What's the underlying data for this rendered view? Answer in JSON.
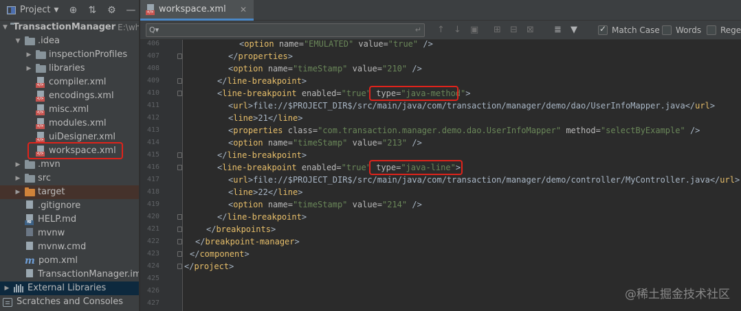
{
  "project_panel": {
    "title": "Project",
    "tree": [
      {
        "label": "TransactionManager",
        "suffix": "E:\\wh",
        "level": 0,
        "kind": "folder",
        "arrow": "▼",
        "bold": true
      },
      {
        "label": ".idea",
        "level": 1,
        "kind": "folder",
        "arrow": "▼"
      },
      {
        "label": "inspectionProfiles",
        "level": 2,
        "kind": "folder",
        "arrow": "▶"
      },
      {
        "label": "libraries",
        "level": 2,
        "kind": "folder",
        "arrow": "▶"
      },
      {
        "label": "compiler.xml",
        "level": 3,
        "kind": "xml"
      },
      {
        "label": "encodings.xml",
        "level": 3,
        "kind": "xml"
      },
      {
        "label": "misc.xml",
        "level": 3,
        "kind": "xml"
      },
      {
        "label": "modules.xml",
        "level": 3,
        "kind": "xml"
      },
      {
        "label": "uiDesigner.xml",
        "level": 3,
        "kind": "xml"
      },
      {
        "label": "workspace.xml",
        "level": 3,
        "kind": "xml"
      },
      {
        "label": ".mvn",
        "level": 1,
        "kind": "folder",
        "arrow": "▶"
      },
      {
        "label": "src",
        "level": 1,
        "kind": "folder",
        "arrow": "▶"
      },
      {
        "label": "target",
        "level": 1,
        "kind": "folder-orange",
        "arrow": "▶",
        "excluded": true
      },
      {
        "label": ".gitignore",
        "level": 2,
        "kind": "ignore"
      },
      {
        "label": "HELP.md",
        "level": 2,
        "kind": "md"
      },
      {
        "label": "mvnw",
        "level": 2,
        "kind": "cmd"
      },
      {
        "label": "mvnw.cmd",
        "level": 2,
        "kind": "plain"
      },
      {
        "label": "pom.xml",
        "level": 2,
        "kind": "maven"
      },
      {
        "label": "TransactionManager.iml",
        "level": 2,
        "kind": "plain"
      },
      {
        "label": "External Libraries",
        "level": 0,
        "kind": "library",
        "arrow": "▶",
        "selected": true
      },
      {
        "label": "Scratches and Consoles",
        "level": 0,
        "kind": "scratch"
      }
    ]
  },
  "editor": {
    "tab_label": "workspace.xml",
    "search": {
      "value": "",
      "options": [
        {
          "label": "Match Case",
          "checked": true
        },
        {
          "label": "Words",
          "checked": false
        },
        {
          "label": "Regex",
          "checked": false
        }
      ]
    },
    "lines": [
      {
        "no": "406",
        "indent": 5,
        "tokens": [
          [
            "x",
            "<"
          ],
          [
            "t",
            "option "
          ],
          [
            "a",
            "name="
          ],
          [
            "v",
            "\"EMULATED\" "
          ],
          [
            "a",
            "value="
          ],
          [
            "v",
            "\"true\" "
          ],
          [
            "x",
            "/>"
          ]
        ]
      },
      {
        "no": "407",
        "indent": 4,
        "tokens": [
          [
            "x",
            "</"
          ],
          [
            "t",
            "properties"
          ],
          [
            "x",
            ">"
          ]
        ]
      },
      {
        "no": "408",
        "indent": 4,
        "tokens": [
          [
            "x",
            "<"
          ],
          [
            "t",
            "option "
          ],
          [
            "a",
            "name="
          ],
          [
            "v",
            "\"timeStamp\" "
          ],
          [
            "a",
            "value="
          ],
          [
            "v",
            "\"210\" "
          ],
          [
            "x",
            "/>"
          ]
        ]
      },
      {
        "no": "409",
        "indent": 3,
        "tokens": [
          [
            "x",
            "</"
          ],
          [
            "t",
            "line-breakpoint"
          ],
          [
            "x",
            ">"
          ]
        ]
      },
      {
        "no": "410",
        "indent": 3,
        "tokens": [
          [
            "x",
            "<"
          ],
          [
            "t",
            "line-breakpoint "
          ],
          [
            "a",
            "enabled="
          ],
          [
            "v",
            "\"true\" "
          ],
          [
            "a",
            "type="
          ],
          [
            "v",
            "\"java-method\""
          ],
          [
            "x",
            ">"
          ]
        ]
      },
      {
        "no": "411",
        "indent": 4,
        "tokens": [
          [
            "x",
            "<"
          ],
          [
            "t",
            "url"
          ],
          [
            "x",
            ">"
          ],
          [
            "x",
            "file://$PROJECT_DIR$/src/main/java/com/transaction/manager/demo/dao/UserInfoMapper.java"
          ],
          [
            "x",
            "</"
          ],
          [
            "t",
            "url"
          ],
          [
            "x",
            ">"
          ]
        ]
      },
      {
        "no": "412",
        "indent": 4,
        "tokens": [
          [
            "x",
            "<"
          ],
          [
            "t",
            "line"
          ],
          [
            "x",
            ">"
          ],
          [
            "x",
            "21"
          ],
          [
            "x",
            "</"
          ],
          [
            "t",
            "line"
          ],
          [
            "x",
            ">"
          ]
        ]
      },
      {
        "no": "413",
        "indent": 4,
        "tokens": [
          [
            "x",
            "<"
          ],
          [
            "t",
            "properties "
          ],
          [
            "a",
            "class="
          ],
          [
            "v",
            "\"com.transaction.manager.demo.dao.UserInfoMapper\" "
          ],
          [
            "a",
            "method="
          ],
          [
            "v",
            "\"selectByExample\" "
          ],
          [
            "x",
            "/>"
          ]
        ]
      },
      {
        "no": "414",
        "indent": 4,
        "tokens": [
          [
            "x",
            "<"
          ],
          [
            "t",
            "option "
          ],
          [
            "a",
            "name="
          ],
          [
            "v",
            "\"timeStamp\" "
          ],
          [
            "a",
            "value="
          ],
          [
            "v",
            "\"213\" "
          ],
          [
            "x",
            "/>"
          ]
        ]
      },
      {
        "no": "415",
        "indent": 3,
        "tokens": [
          [
            "x",
            "</"
          ],
          [
            "t",
            "line-breakpoint"
          ],
          [
            "x",
            ">"
          ]
        ]
      },
      {
        "no": "416",
        "indent": 3,
        "tokens": [
          [
            "x",
            "<"
          ],
          [
            "t",
            "line-breakpoint "
          ],
          [
            "a",
            "enabled="
          ],
          [
            "v",
            "\"true\" "
          ],
          [
            "a",
            "type="
          ],
          [
            "v",
            "\"java-line\""
          ],
          [
            "x",
            ">"
          ]
        ]
      },
      {
        "no": "417",
        "indent": 4,
        "tokens": [
          [
            "x",
            "<"
          ],
          [
            "t",
            "url"
          ],
          [
            "x",
            ">"
          ],
          [
            "x",
            "file://$PROJECT_DIR$/src/main/java/com/transaction/manager/demo/controller/MyController.java"
          ],
          [
            "x",
            "</"
          ],
          [
            "t",
            "url"
          ],
          [
            "x",
            ">"
          ]
        ]
      },
      {
        "no": "418",
        "indent": 4,
        "tokens": [
          [
            "x",
            "<"
          ],
          [
            "t",
            "line"
          ],
          [
            "x",
            ">"
          ],
          [
            "x",
            "22"
          ],
          [
            "x",
            "</"
          ],
          [
            "t",
            "line"
          ],
          [
            "x",
            ">"
          ]
        ]
      },
      {
        "no": "419",
        "indent": 4,
        "tokens": [
          [
            "x",
            "<"
          ],
          [
            "t",
            "option "
          ],
          [
            "a",
            "name="
          ],
          [
            "v",
            "\"timeStamp\" "
          ],
          [
            "a",
            "value="
          ],
          [
            "v",
            "\"214\" "
          ],
          [
            "x",
            "/>"
          ]
        ]
      },
      {
        "no": "420",
        "indent": 3,
        "tokens": [
          [
            "x",
            "</"
          ],
          [
            "t",
            "line-breakpoint"
          ],
          [
            "x",
            ">"
          ]
        ]
      },
      {
        "no": "421",
        "indent": 2,
        "tokens": [
          [
            "x",
            "</"
          ],
          [
            "t",
            "breakpoints"
          ],
          [
            "x",
            ">"
          ]
        ]
      },
      {
        "no": "422",
        "indent": 1,
        "tokens": [
          [
            "x",
            "</"
          ],
          [
            "t",
            "breakpoint-manager"
          ],
          [
            "x",
            ">"
          ]
        ]
      },
      {
        "no": "423",
        "indent": 0.5,
        "tokens": [
          [
            "x",
            "</"
          ],
          [
            "t",
            "component"
          ],
          [
            "x",
            ">"
          ]
        ]
      },
      {
        "no": "424",
        "indent": 0,
        "tokens": [
          [
            "x",
            "</"
          ],
          [
            "t",
            "project"
          ],
          [
            "x",
            ">"
          ]
        ]
      },
      {
        "no": "425",
        "indent": 0,
        "tokens": []
      },
      {
        "no": "426",
        "indent": 0,
        "tokens": []
      },
      {
        "no": "427",
        "indent": 0,
        "tokens": []
      }
    ]
  },
  "watermark": "@稀土掘金技术社区",
  "colors": {
    "background": "#2b2b2b",
    "panel": "#3c3f41",
    "tag": "#e8bf6a",
    "attr_value": "#6a8759",
    "highlight_box": "#e0231b",
    "tab_underline": "#4a88c7"
  }
}
